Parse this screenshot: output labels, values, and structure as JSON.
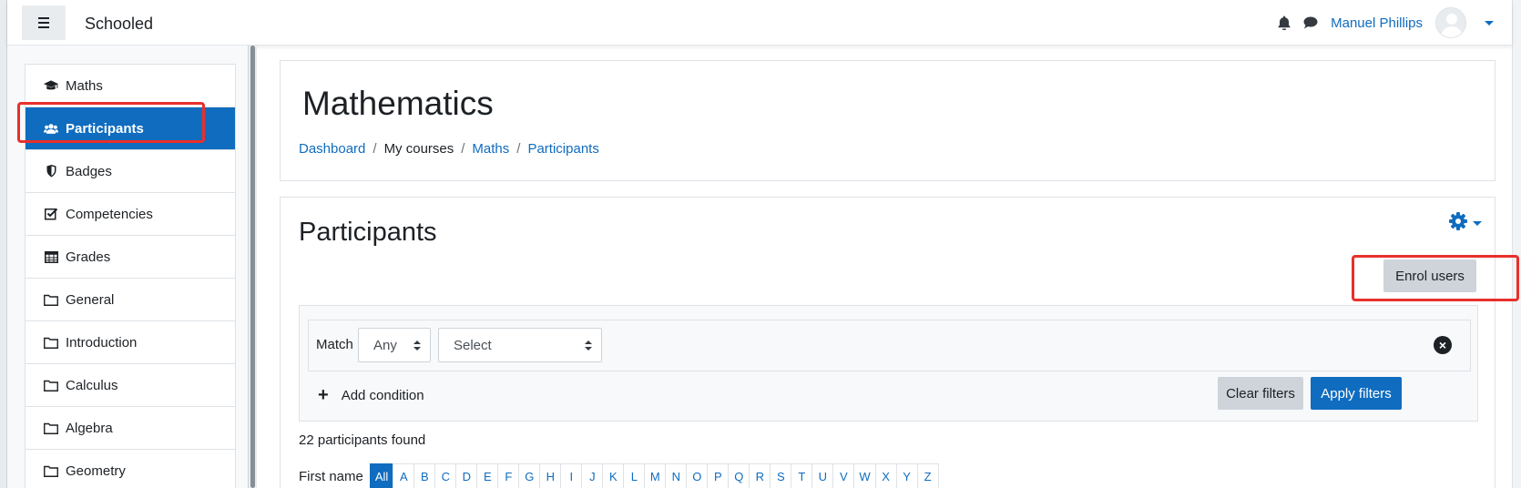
{
  "app": {
    "site_name": "Schooled"
  },
  "navbar": {
    "user_name": "Manuel Phillips",
    "icons": [
      "bell-icon",
      "chat-icon",
      "avatar",
      "chevron-down-icon"
    ]
  },
  "drawer": {
    "items": [
      {
        "label": "Maths",
        "icon": "graduation-cap-icon",
        "active": false
      },
      {
        "label": "Participants",
        "icon": "users-icon",
        "active": true
      },
      {
        "label": "Badges",
        "icon": "shield-icon",
        "active": false
      },
      {
        "label": "Competencies",
        "icon": "check-square-icon",
        "active": false
      },
      {
        "label": "Grades",
        "icon": "table-icon",
        "active": false
      },
      {
        "label": "General",
        "icon": "folder-icon",
        "active": false
      },
      {
        "label": "Introduction",
        "icon": "folder-icon",
        "active": false
      },
      {
        "label": "Calculus",
        "icon": "folder-icon",
        "active": false
      },
      {
        "label": "Algebra",
        "icon": "folder-icon",
        "active": false
      },
      {
        "label": "Geometry",
        "icon": "folder-icon",
        "active": false
      }
    ]
  },
  "header": {
    "title": "Mathematics",
    "breadcrumb": [
      {
        "label": "Dashboard",
        "link": true
      },
      {
        "label": "My courses",
        "link": false
      },
      {
        "label": "Maths",
        "link": true
      },
      {
        "label": "Participants",
        "link": true
      }
    ]
  },
  "main": {
    "title": "Participants",
    "enrol_label": "Enrol users",
    "filter": {
      "match_label": "Match",
      "match_value": "Any",
      "field_value": "Select",
      "add_condition_label": "Add condition",
      "clear_label": "Clear filters",
      "apply_label": "Apply filters"
    },
    "count_text": "22 participants found",
    "initials": {
      "label": "First name",
      "letters": [
        "All",
        "A",
        "B",
        "C",
        "D",
        "E",
        "F",
        "G",
        "H",
        "I",
        "J",
        "K",
        "L",
        "M",
        "N",
        "O",
        "P",
        "Q",
        "R",
        "S",
        "T",
        "U",
        "V",
        "W",
        "X",
        "Y",
        "Z"
      ],
      "selected": "All"
    }
  },
  "colors": {
    "accent": "#0f6cbf",
    "highlight": "#e8302b",
    "secondary_button": "#ced4da"
  }
}
